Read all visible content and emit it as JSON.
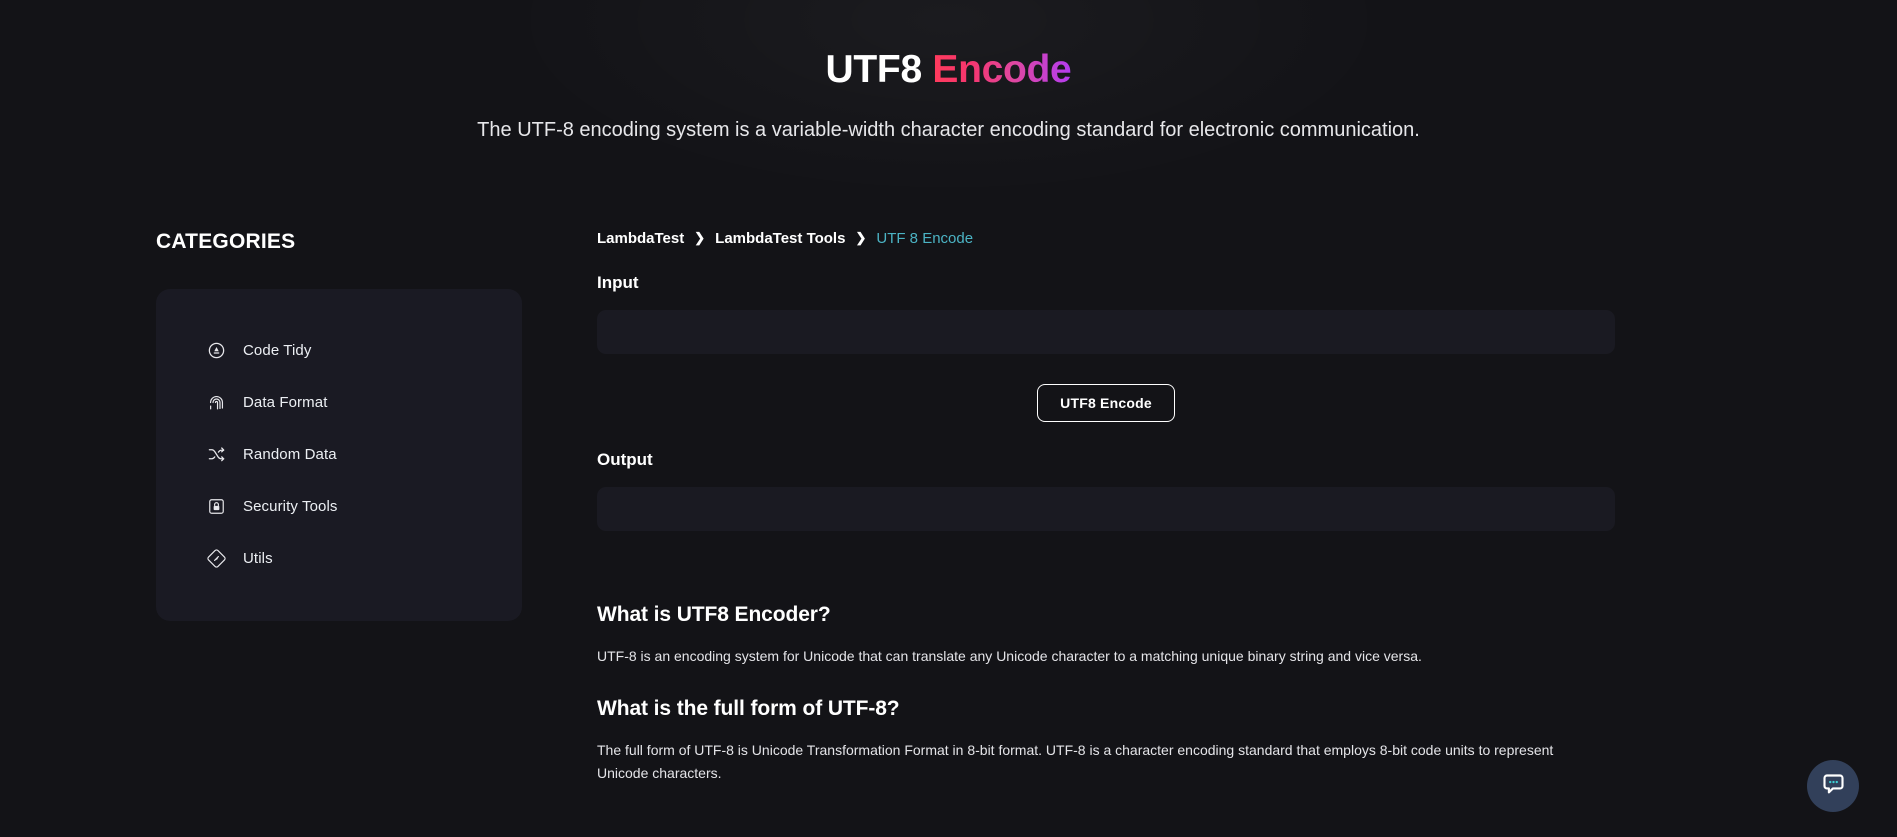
{
  "hero": {
    "title_plain": "UTF8",
    "title_accent": "Encode",
    "subtitle": "The UTF-8 encoding system is a variable-width character encoding standard for electronic communication.",
    "accent_gradient_start": "#ff3b5c",
    "accent_gradient_end": "#b43cf0"
  },
  "sidebar": {
    "title": "CATEGORIES",
    "items": [
      {
        "label": "Code Tidy",
        "icon": "code-tidy-icon"
      },
      {
        "label": "Data Format",
        "icon": "fingerprint-icon"
      },
      {
        "label": "Random Data",
        "icon": "shuffle-icon"
      },
      {
        "label": "Security Tools",
        "icon": "lock-icon"
      },
      {
        "label": "Utils",
        "icon": "diamond-icon"
      }
    ]
  },
  "breadcrumb": {
    "items": [
      {
        "label": "LambdaTest",
        "current": false
      },
      {
        "label": "LambdaTest Tools",
        "current": false
      },
      {
        "label": "UTF 8 Encode",
        "current": true
      }
    ],
    "separator": "❯",
    "current_color": "#4bb3c4"
  },
  "tool": {
    "input_label": "Input",
    "input_value": "",
    "input_placeholder": "",
    "button_label": "UTF8 Encode",
    "output_label": "Output",
    "output_value": "",
    "output_placeholder": ""
  },
  "articles": [
    {
      "heading": "What is UTF8 Encoder?",
      "body": "UTF-8 is an encoding system for Unicode that can translate any Unicode character to a matching unique binary string and vice versa."
    },
    {
      "heading": "What is the full form of UTF-8?",
      "body": "The full form of UTF-8 is Unicode Transformation Format in 8-bit format. UTF-8 is a character encoding standard that employs 8-bit code units to represent Unicode characters."
    }
  ],
  "chat": {
    "icon": "chat-bubble-icon",
    "background_color": "#32405a",
    "dot_color": "#3fd0d4"
  }
}
